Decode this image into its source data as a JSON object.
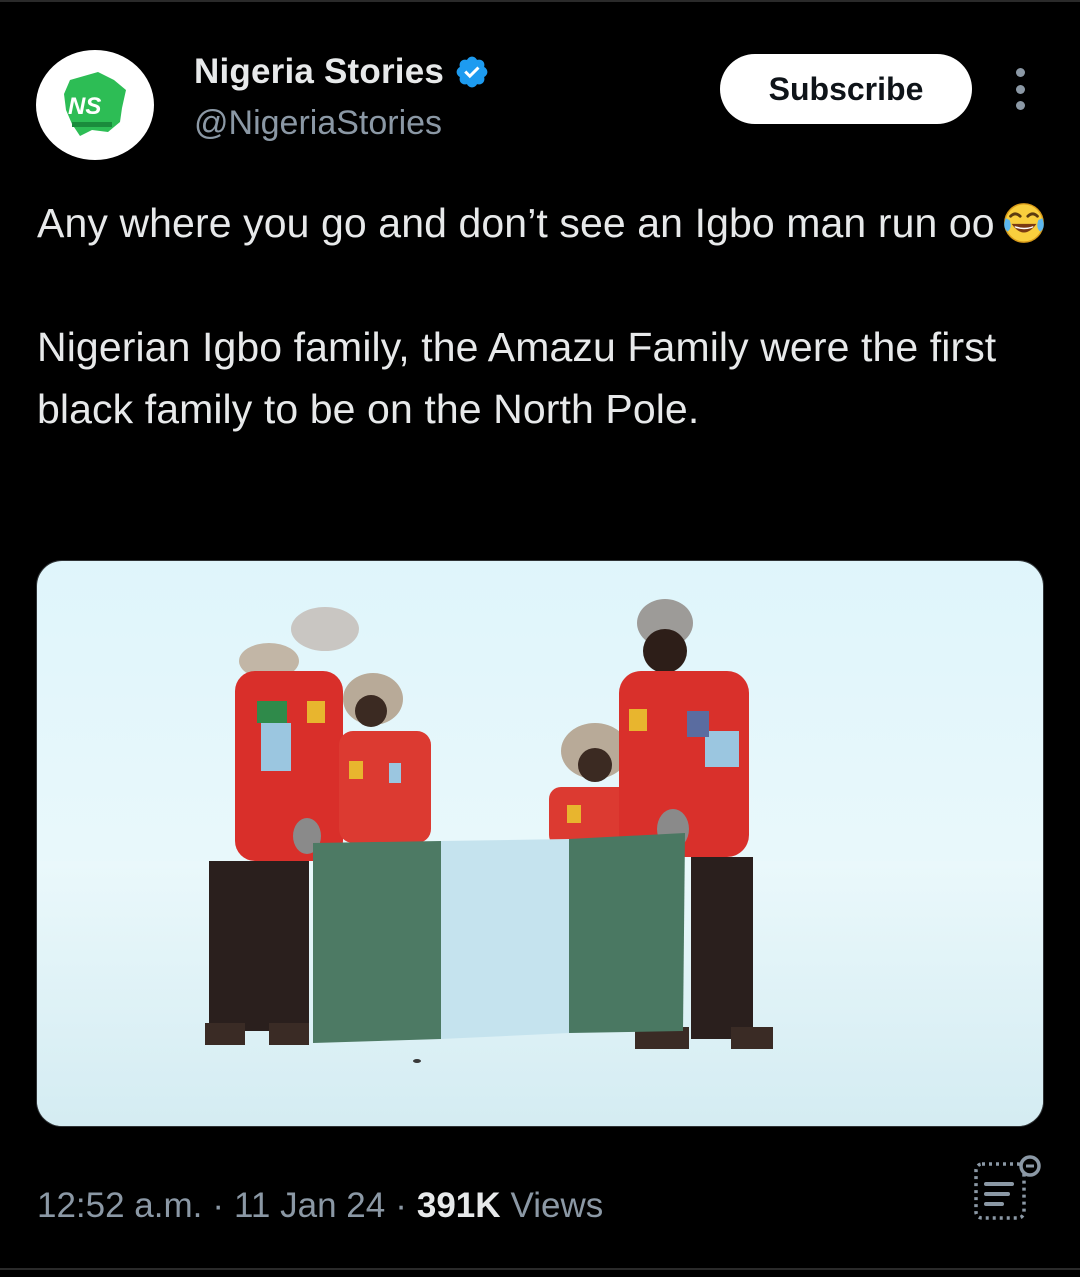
{
  "account": {
    "name": "Nigeria Stories",
    "handle": "@NigeriaStories",
    "avatar_text": "NS",
    "avatar_subtext": "Nigeria Stories",
    "verified": true
  },
  "actions": {
    "subscribe_label": "Subscribe",
    "more_icon": "more-vertical-icon"
  },
  "tweet": {
    "line1": "Any where you go and don’t see an Igbo man run oo",
    "emoji": "face-with-tears-of-joy",
    "line2": "Nigerian Igbo family, the Amazu Family were the first black family to be on the North Pole."
  },
  "media": {
    "description_icon": "photo"
  },
  "meta": {
    "time": "12:52 a.m.",
    "date": "11 Jan 24",
    "views_count": "391K",
    "views_label": "Views",
    "separator": "·"
  },
  "colors": {
    "background": "#000000",
    "text": "#e7e9ea",
    "secondary": "#8b98a5",
    "verified": "#1d9bf0",
    "avatar_green": "#1fa34a"
  }
}
